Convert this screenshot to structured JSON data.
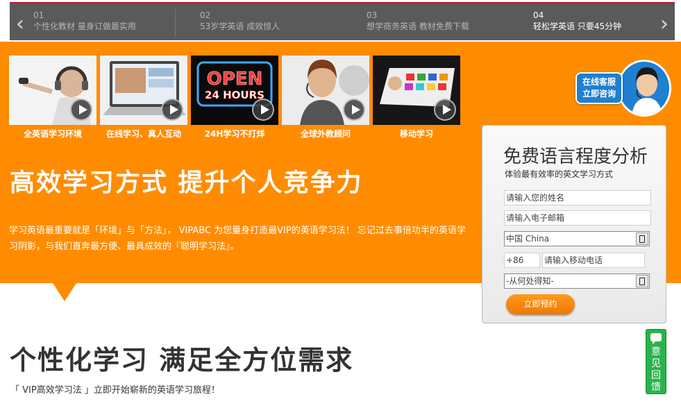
{
  "carousel": {
    "prev_icon": "chevron-left-icon",
    "next_icon": "chevron-right-icon",
    "tabs": [
      {
        "num": "01",
        "text": "个性化教材  量身订做最实用"
      },
      {
        "num": "02",
        "text": "53岁学英语  成效惊人"
      },
      {
        "num": "03",
        "text": "想学商务英语  教材免费下载"
      },
      {
        "num": "04",
        "text": "轻松学英语  只要45分钟"
      }
    ],
    "active_index": 3
  },
  "features": [
    {
      "caption": "全英语学习环境",
      "icon": "headphone-singer-image"
    },
    {
      "caption": "在线学习、真人互动",
      "icon": "laptop-video-image"
    },
    {
      "caption": "24H学习不打烊",
      "image_text": [
        "OPEN",
        "24 HOURS"
      ]
    },
    {
      "caption": "全球外教顾问",
      "icon": "tutor-headset-image"
    },
    {
      "caption": "移动学习",
      "icon": "tablet-apps-image"
    }
  ],
  "hero": {
    "title": "高效学习方式  提升个人竞争力",
    "description": "学习英语最重要就是「环境」与「方法」， VIPABC 为您量身打造最VIP的英语学习法！ 忘记过去事倍功半的英语学习阴影，与我们直奔最方便、最具成效的『聪明学习法』。"
  },
  "online_service": {
    "line1": "在线客服",
    "line2": "立即咨询"
  },
  "form": {
    "title": "免费语言程度分析",
    "subtitle": "体验最有效率的英文学习方式",
    "name_placeholder": "请输入您的姓名",
    "email_placeholder": "请输入电子邮箱",
    "country_value": "中国 China",
    "phone_code": "+86",
    "phone_placeholder": "请输入移动电话",
    "source_value": "-从何处得知-",
    "submit_label": "立即预约"
  },
  "section": {
    "title": "个性化学习  满足全方位需求",
    "subtitle": "「 VIP高效学习法 」立即开始崭新的英语学习旅程！"
  },
  "feedback": {
    "label_chars": [
      "意",
      "见",
      "回",
      "馈"
    ]
  },
  "colors": {
    "orange": "#ff8c00",
    "service_blue": "#1f7fd1",
    "feedback_green": "#2bb24c",
    "carousel_bg": "#5a5a5a"
  }
}
